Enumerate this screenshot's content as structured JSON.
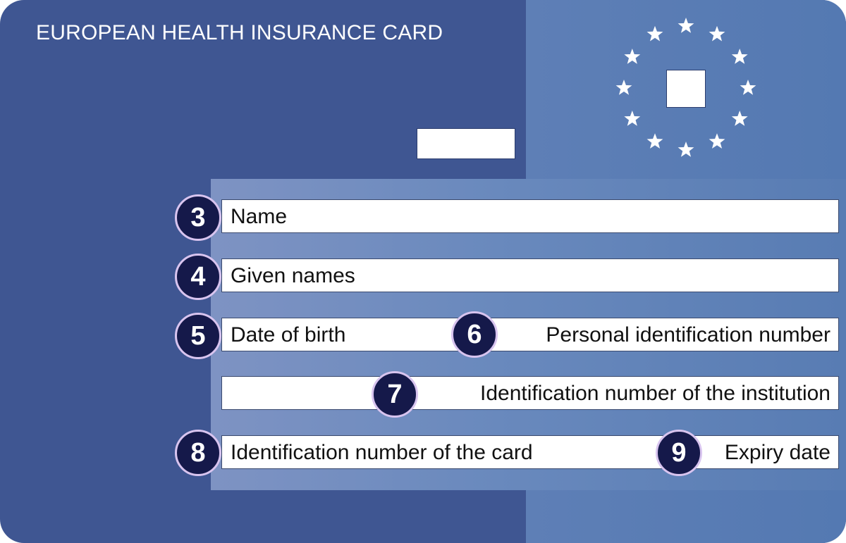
{
  "card": {
    "title": "EUROPEAN HEALTH INSURANCE CARD",
    "colors": {
      "card_blue": "#3f5692",
      "panel_blue": "#5a7cb4",
      "band_blue": "#7189bf",
      "badge": "#15194a",
      "badge_ring": "#d8c4ef"
    }
  },
  "eu_emblem": {
    "icon": "eu-stars-circle-icon",
    "star_count": 12
  },
  "fields": [
    {
      "number": "3",
      "label": "Name"
    },
    {
      "number": "4",
      "label": "Given names"
    },
    {
      "number": "5",
      "label": "Date of birth"
    },
    {
      "number": "6",
      "label": "Personal identification number"
    },
    {
      "number": "7",
      "label": "Identification number of the institution"
    },
    {
      "number": "8",
      "label": "Identification number of the card"
    },
    {
      "number": "9",
      "label": "Expiry date"
    }
  ]
}
